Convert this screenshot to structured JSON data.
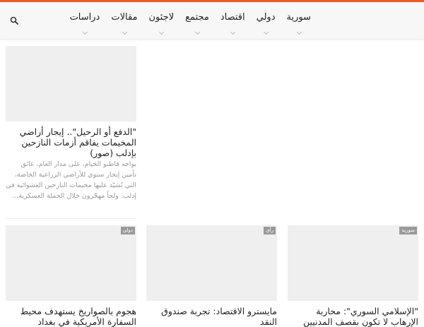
{
  "nav": {
    "items": [
      {
        "label": "سورية"
      },
      {
        "label": "دولي"
      },
      {
        "label": "اقتصاد"
      },
      {
        "label": "مجتمع"
      },
      {
        "label": "لاجئون"
      },
      {
        "label": "مقالات"
      },
      {
        "label": "دراسات"
      }
    ],
    "search_icon": "search-icon",
    "accent_color": "#f15a24"
  },
  "featured": {
    "title": "\"الدفع أو الرحيل\".. إيجار أراضي المخيمات يفاقم أزمات النازحين بإدلب (صور)",
    "excerpt": "يواجه قاطنو الخيام، على مدار العام، عائق تأمين إيجار سنوي للأراضي الزراعية الخاصة، التي تُشيّد عليها مخيمات النازحين العشوائية في إدلب. ولجأ مهجّرون خلال الحملة العسكرية..."
  },
  "cards": [
    {
      "category": "سورية",
      "title": "\"الإسلامي السوري\": محاربة الإرهاب لا تكون بقصف المدنيين"
    },
    {
      "category": "رأي",
      "title": "مايسترو الاقتصاد: تجربة صندوق النقد"
    },
    {
      "category": "دولي",
      "title": "هجوم بالصواريخ يستهدف محيط السفارة الأمريكية في بغداد"
    }
  ]
}
